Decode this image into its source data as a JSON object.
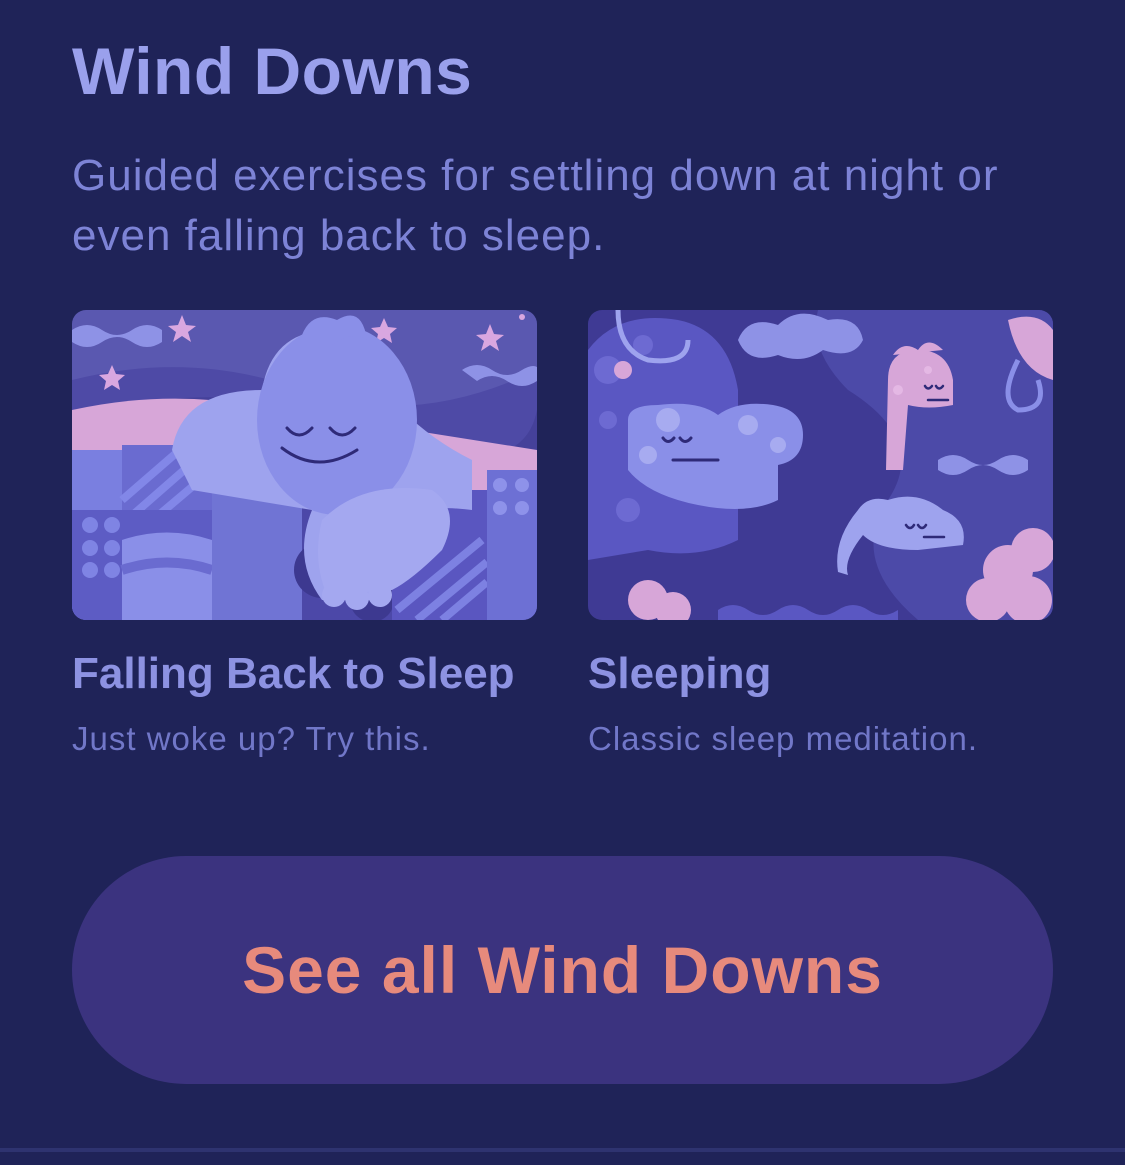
{
  "section": {
    "title": "Wind Downs",
    "subtitle": "Guided exercises for settling down at night or even falling back to sleep."
  },
  "cards": [
    {
      "title": "Falling Back to Sleep",
      "subtitle": "Just woke up? Try this.",
      "illustration": "sleeping-character-under-quilt"
    },
    {
      "title": "Sleeping",
      "subtitle": "Classic sleep meditation.",
      "illustration": "sleepy-creatures-in-water"
    }
  ],
  "cta": {
    "label": "See all Wind Downs"
  },
  "colors": {
    "background": "#1f2358",
    "title": "#9aa0ec",
    "subtitle": "#7d83d6",
    "button_bg": "#3b337f",
    "button_text": "#e78a7c"
  }
}
